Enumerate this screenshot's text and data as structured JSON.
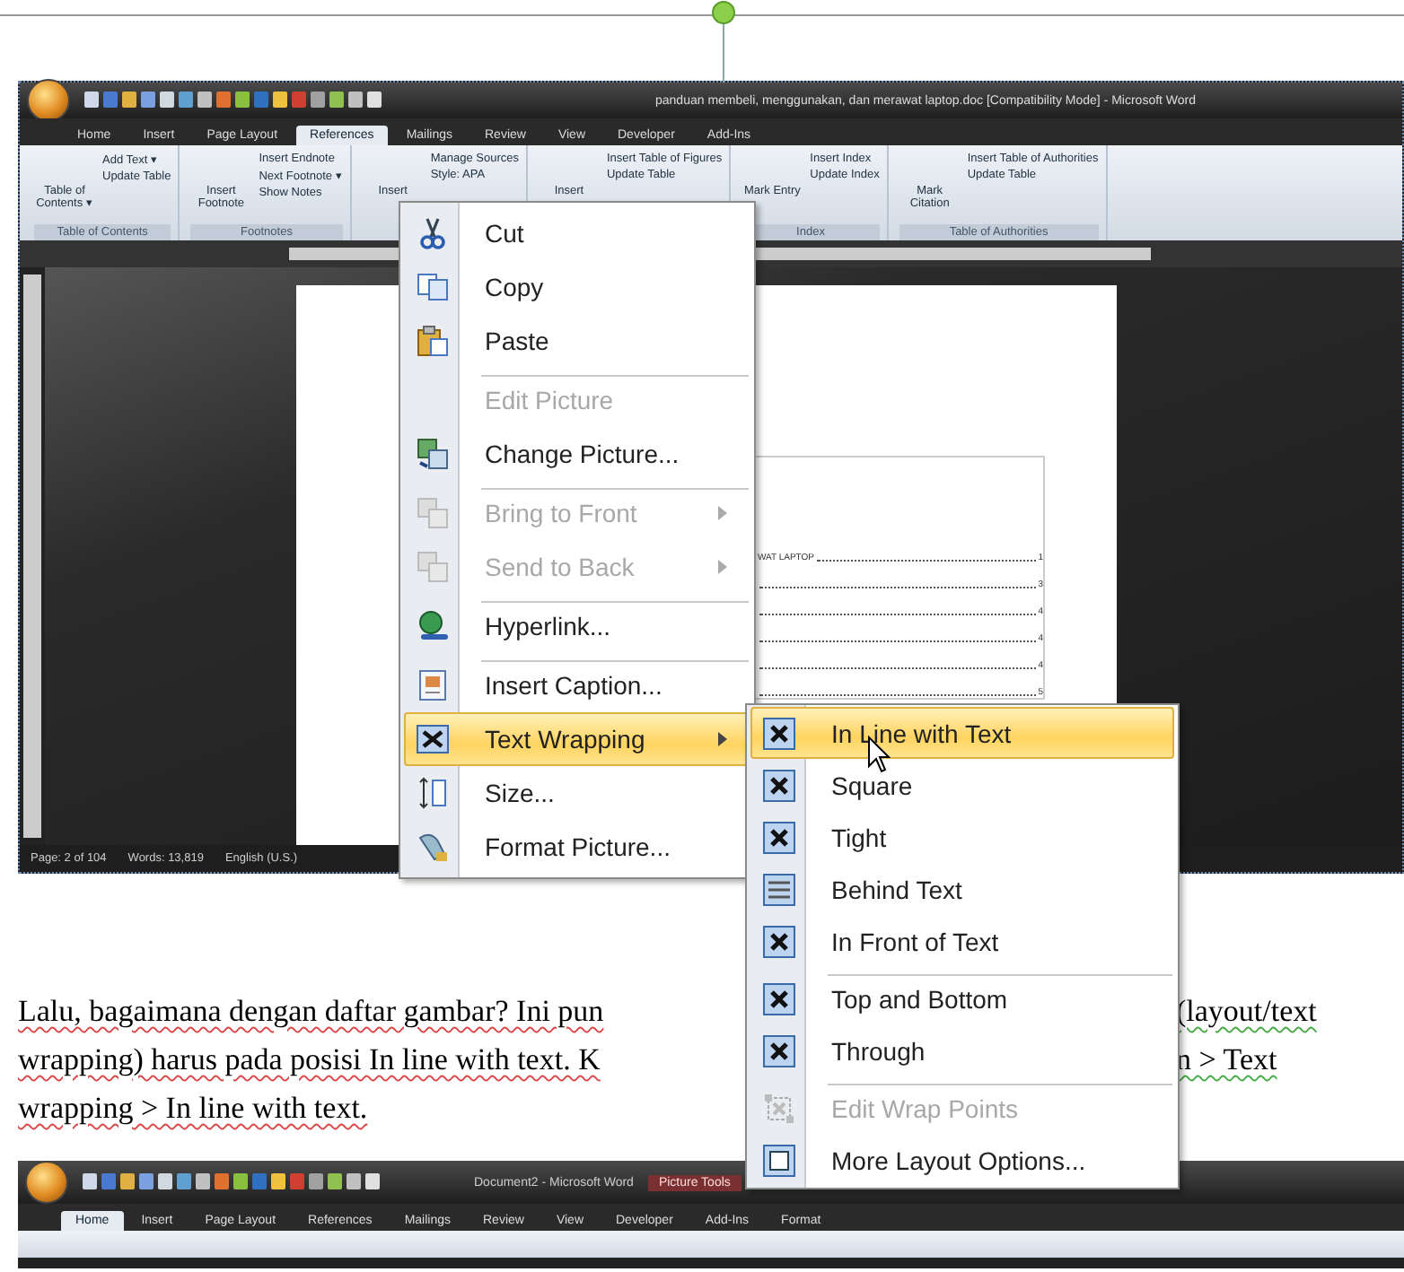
{
  "screenshot_top": {
    "title": "panduan membeli, menggunakan, dan merawat laptop.doc [Compatibility Mode] - Microsoft Word",
    "tabs": [
      {
        "label": "Home",
        "selected": false
      },
      {
        "label": "Insert",
        "selected": false
      },
      {
        "label": "Page Layout",
        "selected": false
      },
      {
        "label": "References",
        "selected": true
      },
      {
        "label": "Mailings",
        "selected": false
      },
      {
        "label": "Review",
        "selected": false
      },
      {
        "label": "View",
        "selected": false
      },
      {
        "label": "Developer",
        "selected": false
      },
      {
        "label": "Add-Ins",
        "selected": false
      }
    ],
    "ribbon_groups": [
      {
        "label": "Table of Contents",
        "big": "Table of Contents ▾",
        "items": [
          "Add Text ▾",
          "Update Table"
        ]
      },
      {
        "label": "Footnotes",
        "big": "Insert Footnote",
        "items": [
          "Insert Endnote",
          "Next Footnote ▾",
          "Show Notes"
        ]
      },
      {
        "big": "Insert",
        "items": [
          "Manage Sources",
          "Style: APA"
        ]
      },
      {
        "big": "Insert",
        "items": [
          "Insert Table of Figures",
          "Update Table"
        ]
      },
      {
        "label": "Index",
        "big": "Mark Entry",
        "items": [
          "Insert Index",
          "Update Index"
        ]
      },
      {
        "label": "Table of Authorities",
        "big": "Mark Citation",
        "items": [
          "Insert Table of Authorities",
          "Update Table"
        ]
      }
    ],
    "toc_lines": [
      {
        "text": "WAT LAPTOP",
        "page": "1"
      },
      {
        "page": "3"
      },
      {
        "page": "4"
      },
      {
        "page": "4"
      },
      {
        "page": "4"
      },
      {
        "page": "5"
      }
    ],
    "status_bar": [
      "Page: 2 of 104",
      "Words: 13,819",
      "English (U.S.)"
    ]
  },
  "context_menu": [
    {
      "label": "Cut",
      "disabled": false,
      "separator_before": false,
      "submenu": false,
      "selected": false
    },
    {
      "label": "Copy",
      "disabled": false,
      "separator_before": false,
      "submenu": false,
      "selected": false
    },
    {
      "label": "Paste",
      "disabled": false,
      "separator_before": false,
      "submenu": false,
      "selected": false
    },
    {
      "label": "Edit Picture",
      "disabled": true,
      "separator_before": true,
      "submenu": false,
      "selected": false
    },
    {
      "label": "Change Picture...",
      "disabled": false,
      "separator_before": false,
      "submenu": false,
      "selected": false
    },
    {
      "label": "Bring to Front",
      "disabled": true,
      "separator_before": true,
      "submenu": true,
      "selected": false
    },
    {
      "label": "Send to Back",
      "disabled": true,
      "separator_before": false,
      "submenu": true,
      "selected": false
    },
    {
      "label": "Hyperlink...",
      "disabled": false,
      "separator_before": true,
      "submenu": false,
      "selected": false
    },
    {
      "label": "Insert Caption...",
      "disabled": false,
      "separator_before": true,
      "submenu": false,
      "selected": false
    },
    {
      "label": "Text Wrapping",
      "disabled": false,
      "separator_before": false,
      "submenu": true,
      "selected": true
    },
    {
      "label": "Size...",
      "disabled": false,
      "separator_before": false,
      "submenu": false,
      "selected": false
    },
    {
      "label": "Format Picture...",
      "disabled": false,
      "separator_before": false,
      "submenu": false,
      "selected": false
    }
  ],
  "wrap_submenu": [
    {
      "label": "In Line with Text",
      "disabled": false,
      "separator_before": false,
      "selected": true
    },
    {
      "label": "Square",
      "disabled": false,
      "separator_before": false,
      "selected": false
    },
    {
      "label": "Tight",
      "disabled": false,
      "separator_before": false,
      "selected": false
    },
    {
      "label": "Behind Text",
      "disabled": false,
      "separator_before": false,
      "selected": false
    },
    {
      "label": "In Front of Text",
      "disabled": false,
      "separator_before": false,
      "selected": false
    },
    {
      "label": "Top and Bottom",
      "disabled": false,
      "separator_before": true,
      "selected": false
    },
    {
      "label": "Through",
      "disabled": false,
      "separator_before": false,
      "selected": false
    },
    {
      "label": "Edit Wrap Points",
      "disabled": true,
      "separator_before": true,
      "selected": false
    },
    {
      "label": "More Layout Options...",
      "disabled": false,
      "separator_before": false,
      "selected": false
    }
  ],
  "paragraph_lines": [
    {
      "left": "Lalu, bagaimana dengan daftar gambar? Ini pun",
      "right": "(layout/text"
    },
    {
      "left": "wrapping) harus pada posisi  In line with text. K",
      "right": "n > Text"
    },
    {
      "left": "wrapping > In line with text."
    }
  ],
  "screenshot_bottom": {
    "title": "Document2 - Microsoft Word",
    "context_tab": "Picture Tools",
    "tabs": [
      {
        "label": "Home",
        "selected": true
      },
      {
        "label": "Insert",
        "selected": false
      },
      {
        "label": "Page Layout",
        "selected": false
      },
      {
        "label": "References",
        "selected": false
      },
      {
        "label": "Mailings",
        "selected": false
      },
      {
        "label": "Review",
        "selected": false
      },
      {
        "label": "View",
        "selected": false
      },
      {
        "label": "Developer",
        "selected": false
      },
      {
        "label": "Add-Ins",
        "selected": false
      },
      {
        "label": "Format",
        "selected": false
      }
    ]
  }
}
